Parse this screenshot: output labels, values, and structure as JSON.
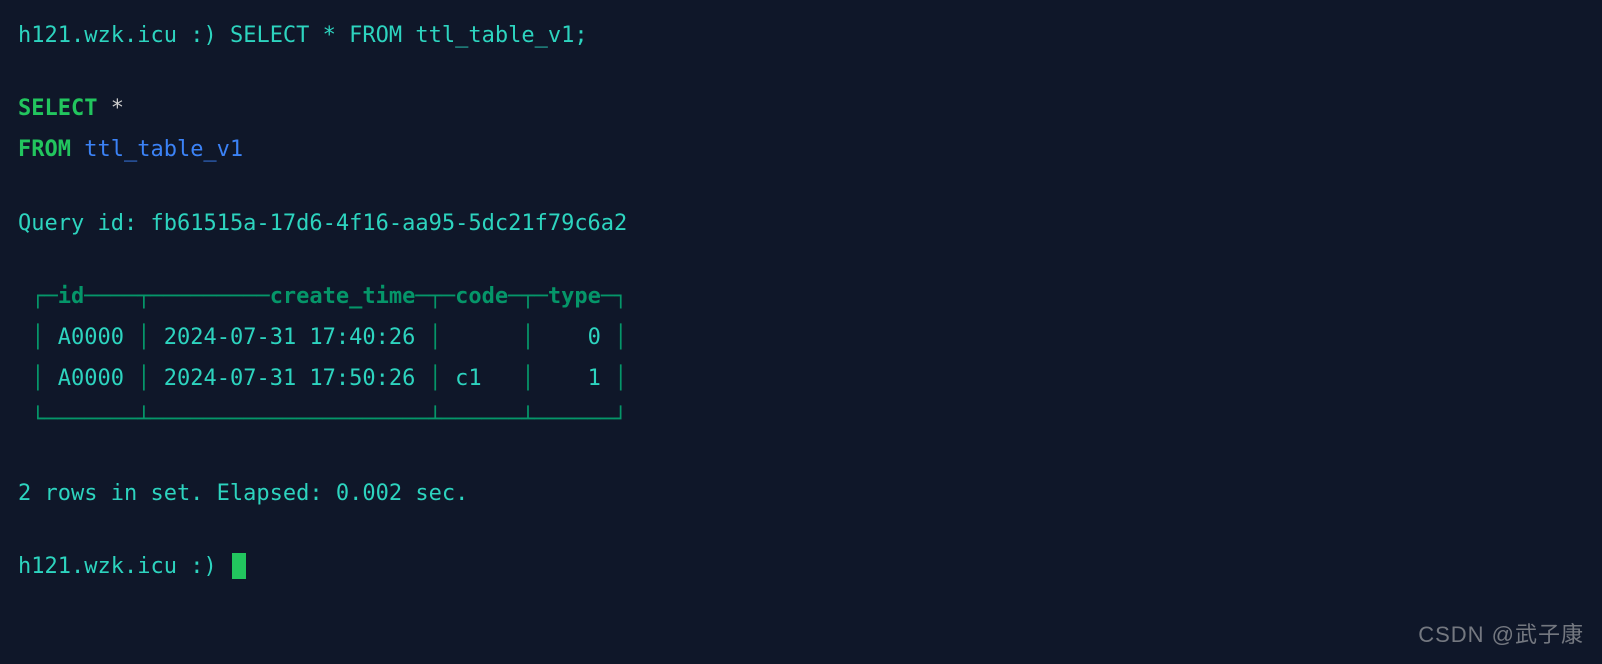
{
  "prompt": {
    "host": "h121.wzk.icu",
    "smiley": ":)",
    "input_sql": "SELECT * FROM ttl_table_v1;"
  },
  "echo_sql": {
    "line1_kw": "SELECT",
    "line1_star": " *",
    "line2_kw": "FROM",
    "line2_ident": " ttl_table_v1"
  },
  "query_id_label": "Query id:",
  "query_id_value": "fb61515a-17d6-4f16-aa95-5dc21f79c6a2",
  "table": {
    "headers": [
      "id",
      "create_time",
      "code",
      "type"
    ],
    "rows": [
      {
        "id": "A0000",
        "create_time": "2024-07-31 17:40:26",
        "code": "",
        "type": "0"
      },
      {
        "id": "A0000",
        "create_time": "2024-07-31 17:50:26",
        "code": "c1",
        "type": "1"
      }
    ]
  },
  "status_line": "2 rows in set. Elapsed: 0.002 sec.",
  "prompt2": {
    "host": "h121.wzk.icu",
    "smiley": ":)"
  },
  "watermark": "CSDN @武子康",
  "chart_data": {
    "type": "table",
    "title": "SELECT * FROM ttl_table_v1",
    "columns": [
      "id",
      "create_time",
      "code",
      "type"
    ],
    "rows": [
      [
        "A0000",
        "2024-07-31 17:40:26",
        "",
        0
      ],
      [
        "A0000",
        "2024-07-31 17:50:26",
        "c1",
        1
      ]
    ]
  }
}
